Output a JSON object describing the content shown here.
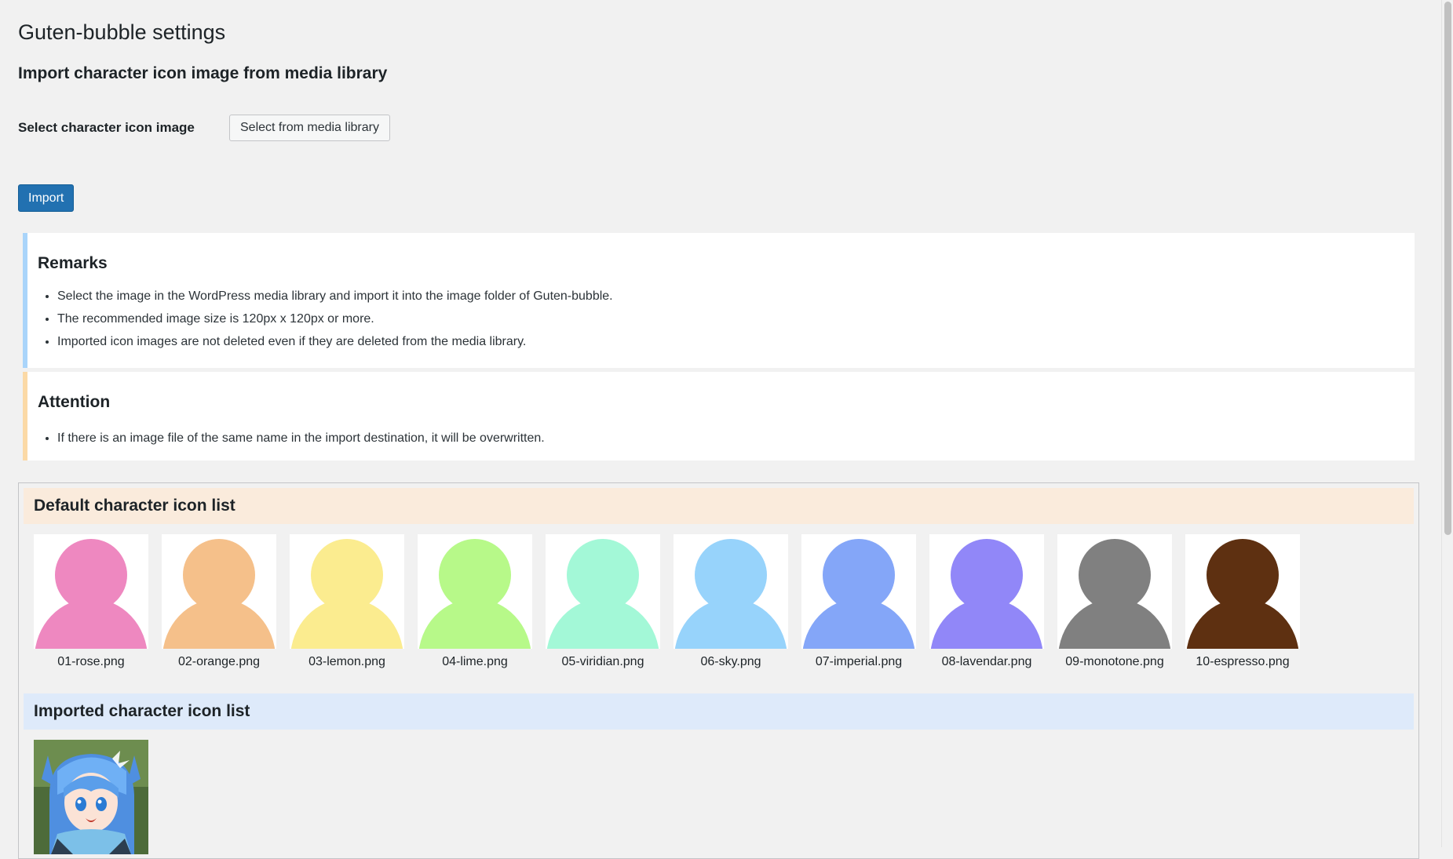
{
  "page": {
    "title": "Guten-bubble settings",
    "import_heading": "Import character icon image from media library",
    "select_label": "Select character icon image",
    "select_button": "Select from media library",
    "import_button": "Import"
  },
  "remarks": {
    "title": "Remarks",
    "items": [
      "Select the image in the WordPress media library and import it into the image folder of Guten-bubble.",
      "The recommended image size is 120px x 120px or more.",
      "Imported icon images are not deleted even if they are deleted from the media library."
    ]
  },
  "attention": {
    "title": "Attention",
    "items": [
      "If there is an image file of the same name in the import destination, it will be overwritten."
    ]
  },
  "default_list": {
    "title": "Default character icon list",
    "icons": [
      {
        "name": "01-rose.png",
        "color": "#ee88c0"
      },
      {
        "name": "02-orange.png",
        "color": "#f5c08a"
      },
      {
        "name": "03-lemon.png",
        "color": "#fbec8f"
      },
      {
        "name": "04-lime.png",
        "color": "#b7f989"
      },
      {
        "name": "05-viridian.png",
        "color": "#a3f8d7"
      },
      {
        "name": "06-sky.png",
        "color": "#97d3fb"
      },
      {
        "name": "07-imperial.png",
        "color": "#84a6f8"
      },
      {
        "name": "08-lavendar.png",
        "color": "#9187f8"
      },
      {
        "name": "09-monotone.png",
        "color": "#808080"
      },
      {
        "name": "10-espresso.png",
        "color": "#5e3011"
      }
    ]
  },
  "imported_list": {
    "title": "Imported character icon list",
    "icons": [
      {
        "icon": "anime-character-thumbnail"
      }
    ]
  },
  "colors": {
    "primary": "#2271b1",
    "remarks_accent": "#a9d4fa",
    "attention_accent": "#fbd9a6",
    "default_header_bg": "#faebdc",
    "imported_header_bg": "#deeafa"
  }
}
